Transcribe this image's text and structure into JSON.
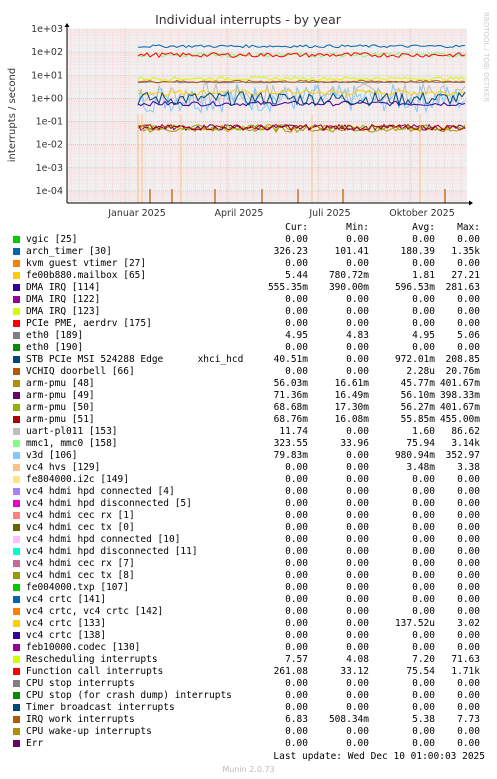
{
  "title": "Individual interrupts - by year",
  "rrdtool_label": "RRDTOOL / TOBI OETIKER",
  "footer": {
    "last_update": "Last update: Wed Dec 10 01:00:03 2025",
    "version": "Munin 2.0.73"
  },
  "legend_headers": {
    "cur": "Cur:",
    "min": "Min:",
    "avg": "Avg:",
    "max": "Max:"
  },
  "chart_data": {
    "type": "line",
    "title": "Individual interrupts - by year",
    "ylabel": "interrupts / second",
    "y_scale": "log",
    "ylim": [
      3e-05,
      1000
    ],
    "y_ticks": [
      "1e-04",
      "1e-03",
      "1e-02",
      "1e-01",
      "1e+00",
      "1e+01",
      "1e+02",
      "1e+03"
    ],
    "x_ticks": [
      "Januar 2025",
      "April 2025",
      "Juli 2025",
      "Oktober 2025"
    ],
    "grid": true,
    "legend_placement": "bottom",
    "series": [
      {
        "name": "vgic [25]",
        "color": "#00cc00",
        "cur": "0.00",
        "min": "0.00",
        "avg": "0.00",
        "max": "0.00"
      },
      {
        "name": "arch_timer [30]",
        "color": "#0066b3",
        "cur": "326.23",
        "min": "101.41",
        "avg": "180.39",
        "max": "1.35k"
      },
      {
        "name": "kvm guest vtimer [27]",
        "color": "#ff8000",
        "cur": "0.00",
        "min": "0.00",
        "avg": "0.00",
        "max": "0.00"
      },
      {
        "name": "fe00b880.mailbox [65]",
        "color": "#ffcc00",
        "cur": "5.44",
        "min": "780.72m",
        "avg": "1.81",
        "max": "27.21"
      },
      {
        "name": "DMA IRQ [114]",
        "color": "#330099",
        "cur": "555.35m",
        "min": "390.00m",
        "avg": "596.53m",
        "max": "281.63"
      },
      {
        "name": "DMA IRQ [122]",
        "color": "#990099",
        "cur": "0.00",
        "min": "0.00",
        "avg": "0.00",
        "max": "0.00"
      },
      {
        "name": "DMA IRQ [123]",
        "color": "#ccff00",
        "cur": "0.00",
        "min": "0.00",
        "avg": "0.00",
        "max": "0.00"
      },
      {
        "name": "PCIe PME, aerdrv [175]",
        "color": "#ff0000",
        "cur": "0.00",
        "min": "0.00",
        "avg": "0.00",
        "max": "0.00"
      },
      {
        "name": "eth0 [189]",
        "color": "#808080",
        "cur": "4.95",
        "min": "4.83",
        "avg": "4.95",
        "max": "5.06"
      },
      {
        "name": "eth0 [190]",
        "color": "#008f00",
        "cur": "0.00",
        "min": "0.00",
        "avg": "0.00",
        "max": "0.00"
      },
      {
        "name": "STB PCIe MSI 524288 Edge      xhci_hcd",
        "color": "#00487d",
        "cur": "40.51m",
        "min": "0.00",
        "avg": "972.01m",
        "max": "208.85"
      },
      {
        "name": "VCHIQ doorbell [66]",
        "color": "#b35a00",
        "cur": "0.00",
        "min": "0.00",
        "avg": "2.28u",
        "max": "20.76m"
      },
      {
        "name": "arm-pmu [48]",
        "color": "#b38f00",
        "cur": "56.03m",
        "min": "16.61m",
        "avg": "45.77m",
        "max": "401.67m"
      },
      {
        "name": "arm-pmu [49]",
        "color": "#6b006b",
        "cur": "71.36m",
        "min": "16.49m",
        "avg": "56.10m",
        "max": "398.33m"
      },
      {
        "name": "arm-pmu [50]",
        "color": "#8fb300",
        "cur": "68.68m",
        "min": "17.30m",
        "avg": "56.27m",
        "max": "401.67m"
      },
      {
        "name": "arm-pmu [51]",
        "color": "#b30000",
        "cur": "68.76m",
        "min": "16.08m",
        "avg": "55.85m",
        "max": "455.00m"
      },
      {
        "name": "uart-pl011 [153]",
        "color": "#bebebe",
        "cur": "11.74",
        "min": "0.00",
        "avg": "1.60",
        "max": "86.62"
      },
      {
        "name": "mmc1, mmc0 [158]",
        "color": "#80ff80",
        "cur": "323.55",
        "min": "33.96",
        "avg": "75.94",
        "max": "3.14k"
      },
      {
        "name": "v3d [106]",
        "color": "#80c9ff",
        "cur": "79.83m",
        "min": "0.00",
        "avg": "980.94m",
        "max": "352.97"
      },
      {
        "name": "vc4 hvs [129]",
        "color": "#ffc080",
        "cur": "0.00",
        "min": "0.00",
        "avg": "3.48m",
        "max": "3.38"
      },
      {
        "name": "fe804000.i2c [149]",
        "color": "#ffe680",
        "cur": "0.00",
        "min": "0.00",
        "avg": "0.00",
        "max": "0.00"
      },
      {
        "name": "vc4 hdmi hpd connected [4]",
        "color": "#aa80ff",
        "cur": "0.00",
        "min": "0.00",
        "avg": "0.00",
        "max": "0.00"
      },
      {
        "name": "vc4 hdmi hpd disconnected [5]",
        "color": "#ee00cc",
        "cur": "0.00",
        "min": "0.00",
        "avg": "0.00",
        "max": "0.00"
      },
      {
        "name": "vc4 hdmi cec rx [1]",
        "color": "#ff8080",
        "cur": "0.00",
        "min": "0.00",
        "avg": "0.00",
        "max": "0.00"
      },
      {
        "name": "vc4 hdmi cec tx [0]",
        "color": "#666600",
        "cur": "0.00",
        "min": "0.00",
        "avg": "0.00",
        "max": "0.00"
      },
      {
        "name": "vc4 hdmi hpd connected [10]",
        "color": "#ffbfff",
        "cur": "0.00",
        "min": "0.00",
        "avg": "0.00",
        "max": "0.00"
      },
      {
        "name": "vc4 hdmi hpd disconnected [11]",
        "color": "#00ffcc",
        "cur": "0.00",
        "min": "0.00",
        "avg": "0.00",
        "max": "0.00"
      },
      {
        "name": "vc4 hdmi cec rx [7]",
        "color": "#cc6699",
        "cur": "0.00",
        "min": "0.00",
        "avg": "0.00",
        "max": "0.00"
      },
      {
        "name": "vc4 hdmi cec tx [8]",
        "color": "#999900",
        "cur": "0.00",
        "min": "0.00",
        "avg": "0.00",
        "max": "0.00"
      },
      {
        "name": "fe004000.txp [107]",
        "color": "#00cc00",
        "cur": "0.00",
        "min": "0.00",
        "avg": "0.00",
        "max": "0.00"
      },
      {
        "name": "vc4 crtc [141]",
        "color": "#0066b3",
        "cur": "0.00",
        "min": "0.00",
        "avg": "0.00",
        "max": "0.00"
      },
      {
        "name": "vc4 crtc, vc4 crtc [142]",
        "color": "#ff8000",
        "cur": "0.00",
        "min": "0.00",
        "avg": "0.00",
        "max": "0.00"
      },
      {
        "name": "vc4 crtc [133]",
        "color": "#ffcc00",
        "cur": "0.00",
        "min": "0.00",
        "avg": "137.52u",
        "max": "3.02"
      },
      {
        "name": "vc4 crtc [138]",
        "color": "#330099",
        "cur": "0.00",
        "min": "0.00",
        "avg": "0.00",
        "max": "0.00"
      },
      {
        "name": "feb10000.codec [130]",
        "color": "#990099",
        "cur": "0.00",
        "min": "0.00",
        "avg": "0.00",
        "max": "0.00"
      },
      {
        "name": "Rescheduling interrupts",
        "color": "#ccff00",
        "cur": "7.57",
        "min": "4.08",
        "avg": "7.20",
        "max": "71.63"
      },
      {
        "name": "Function call interrupts",
        "color": "#ff0000",
        "cur": "261.08",
        "min": "33.12",
        "avg": "75.54",
        "max": "1.71k"
      },
      {
        "name": "CPU stop interrupts",
        "color": "#808080",
        "cur": "0.00",
        "min": "0.00",
        "avg": "0.00",
        "max": "0.00"
      },
      {
        "name": "CPU stop (for crash dump) interrupts",
        "color": "#008f00",
        "cur": "0.00",
        "min": "0.00",
        "avg": "0.00",
        "max": "0.00"
      },
      {
        "name": "Timer broadcast interrupts",
        "color": "#00487d",
        "cur": "0.00",
        "min": "0.00",
        "avg": "0.00",
        "max": "0.00"
      },
      {
        "name": "IRQ work interrupts",
        "color": "#b35a00",
        "cur": "6.83",
        "min": "508.34m",
        "avg": "5.38",
        "max": "7.73"
      },
      {
        "name": "CPU wake-up interrupts",
        "color": "#b38f00",
        "cur": "0.00",
        "min": "0.00",
        "avg": "0.00",
        "max": "0.00"
      },
      {
        "name": "Err",
        "color": "#6b006b",
        "cur": "0.00",
        "min": "0.00",
        "avg": "0.00",
        "max": "0.00"
      }
    ]
  }
}
